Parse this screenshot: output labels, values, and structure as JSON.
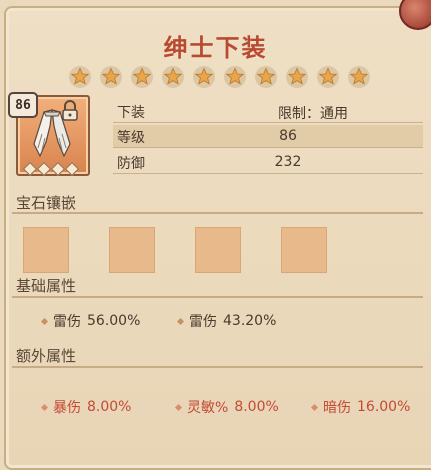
{
  "title": "绅士下装",
  "stars_count": 10,
  "item": {
    "level": "86",
    "icon": "white-feathered-pants-icon",
    "locked": true,
    "socket_diamonds": 4
  },
  "info": {
    "rows": [
      {
        "label": "下装",
        "value": "限制：通用"
      },
      {
        "label": "等级",
        "value": "86"
      },
      {
        "label": "防御",
        "value": "232"
      }
    ]
  },
  "sections": {
    "gems": "宝石镶嵌",
    "base": "基础属性",
    "extra": "额外属性"
  },
  "gem_slots": 4,
  "base_attrs": [
    {
      "name": "雷伤",
      "value": "56.00%"
    },
    {
      "name": "雷伤",
      "value": "43.20%"
    }
  ],
  "extra_attrs": [
    {
      "name": "暴伤",
      "value": "8.00%"
    },
    {
      "name": "灵敏%",
      "value": "8.00%"
    },
    {
      "name": "暗伤",
      "value": "16.00%"
    }
  ],
  "colors": {
    "title": "#b94a32",
    "base_attr_text": "#4a3a2e",
    "extra_attr_text": "#c44a34",
    "star": "#e9a54a"
  }
}
